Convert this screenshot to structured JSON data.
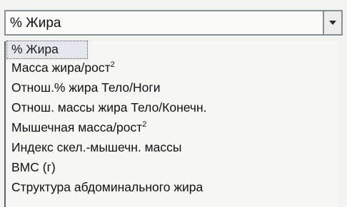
{
  "dropdown": {
    "selected_value": "% Жира",
    "arrow_icon": "chevron-down-icon",
    "options": [
      {
        "label": "% Жира",
        "sup": ""
      },
      {
        "label": "Масса жира/рост",
        "sup": "2"
      },
      {
        "label": "Отнош.% жира Тело/Ноги",
        "sup": ""
      },
      {
        "label": "Отнош. массы жира Тело/Конечн.",
        "sup": ""
      },
      {
        "label": "Мышечная масса/рост",
        "sup": "2"
      },
      {
        "label": "Индекс скел.-мышечн. массы",
        "sup": ""
      },
      {
        "label": "BMC (г)",
        "sup": ""
      },
      {
        "label": "Структура абдоминального жира",
        "sup": ""
      }
    ]
  }
}
